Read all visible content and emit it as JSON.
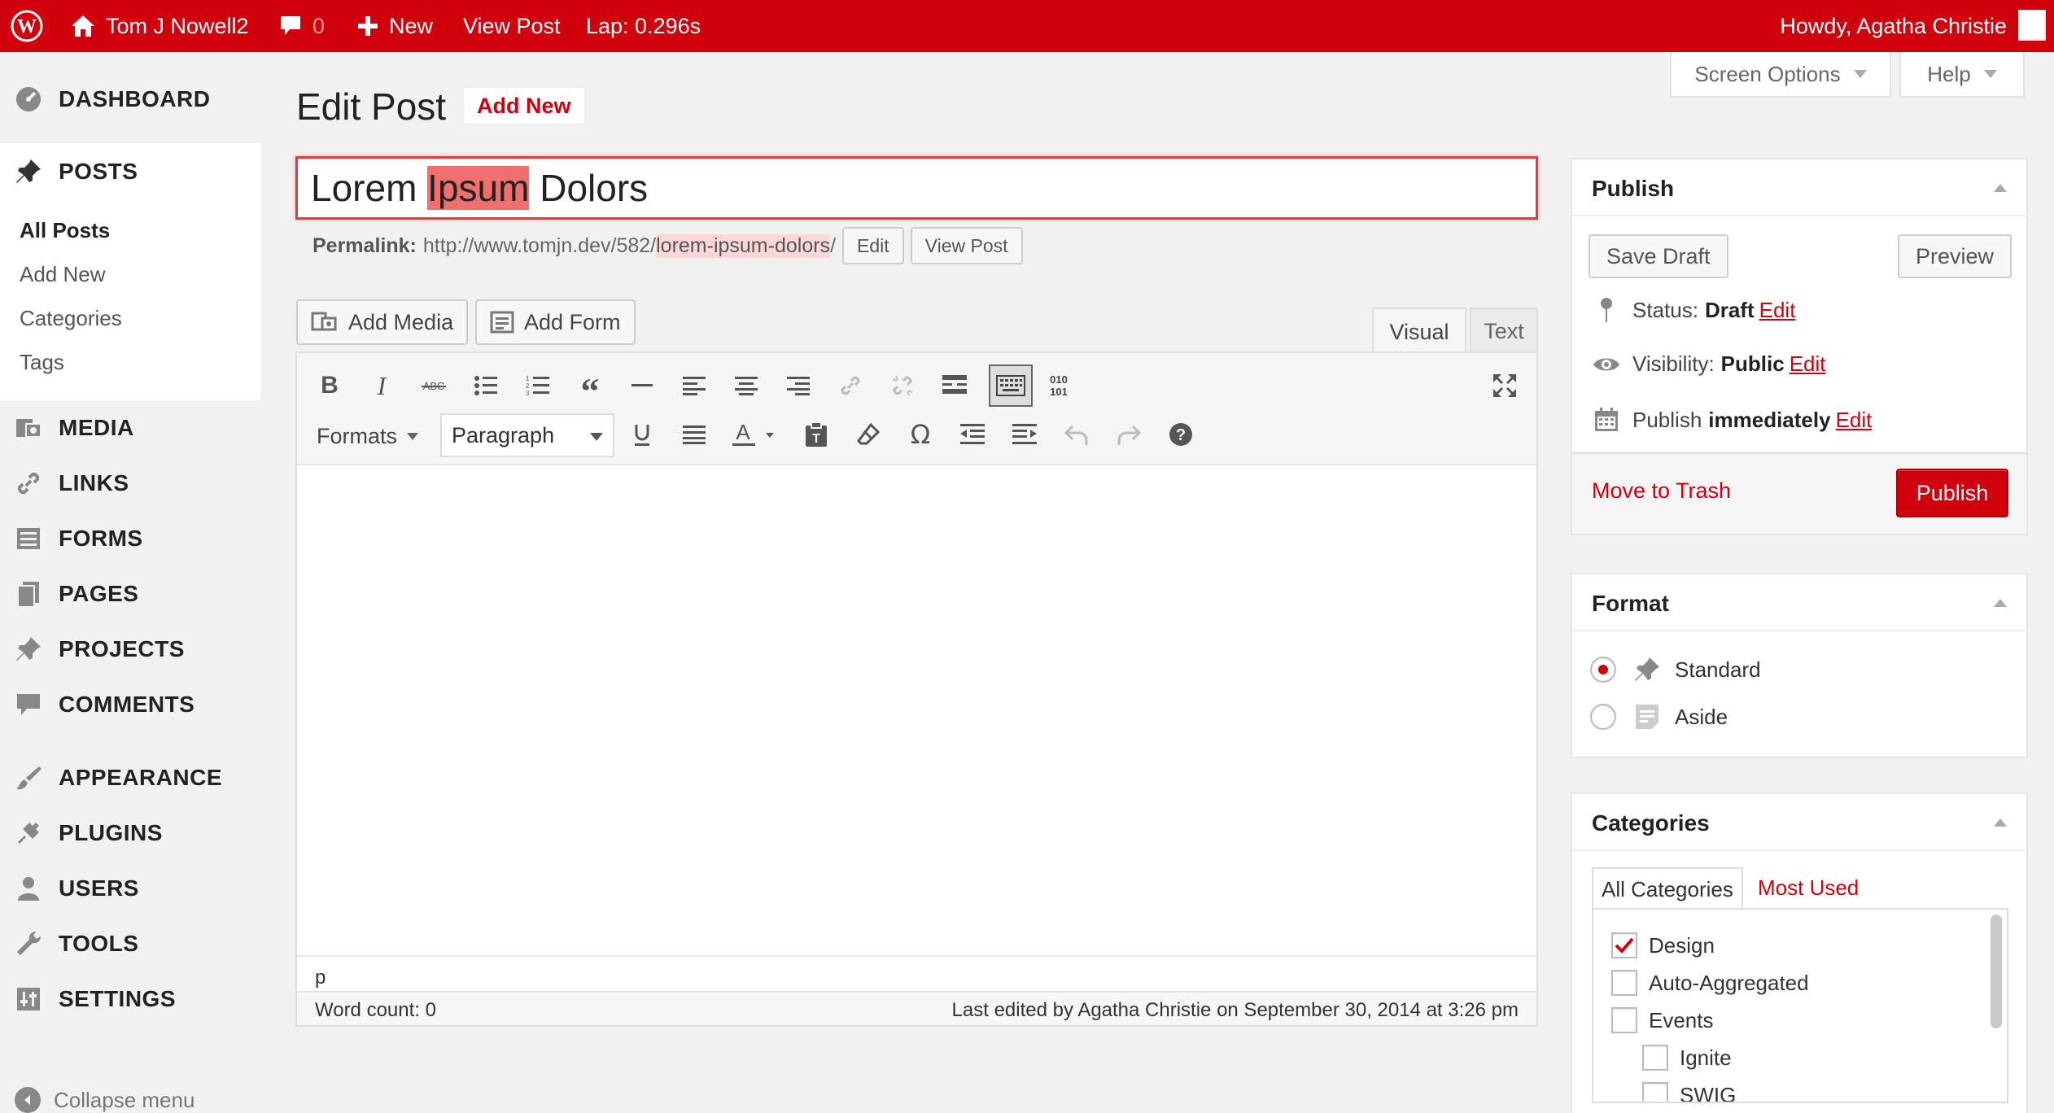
{
  "admin_bar": {
    "site_name": "Tom J Nowell2",
    "comments_count": "0",
    "new_label": "New",
    "view_post_label": "View Post",
    "lap": "Lap: 0.296s",
    "howdy": "Howdy, Agatha Christie"
  },
  "sidebar": {
    "dashboard": "Dashboard",
    "posts": "Posts",
    "submenu": {
      "all_posts": "All Posts",
      "add_new": "Add New",
      "categories": "Categories",
      "tags": "Tags"
    },
    "media": "Media",
    "links": "Links",
    "forms": "Forms",
    "pages": "Pages",
    "projects": "Projects",
    "comments": "Comments",
    "appearance": "Appearance",
    "plugins": "Plugins",
    "users": "Users",
    "tools": "Tools",
    "settings": "Settings",
    "collapse": "Collapse menu"
  },
  "screen_meta": {
    "screen_options": "Screen Options",
    "help": "Help"
  },
  "heading": {
    "title": "Edit Post",
    "add_new": "Add New"
  },
  "post": {
    "title_before": "Lorem ",
    "title_highlight": "Ipsum",
    "title_after": " Dolors",
    "permalink_label": "Permalink:",
    "permalink_base": "http://www.tomjn.dev/582/",
    "permalink_slug": "lorem-ipsum-dolors",
    "permalink_trail": "/",
    "permalink_edit": "Edit",
    "permalink_view": "View Post"
  },
  "media_buttons": {
    "add_media": "Add Media",
    "add_form": "Add Form"
  },
  "editor": {
    "tab_visual": "Visual",
    "tab_text": "Text",
    "formats": "Formats",
    "paragraph": "Paragraph",
    "path": "p",
    "word_count": "Word count: 0",
    "last_edited": "Last edited by Agatha Christie on September 30, 2014 at 3:26 pm",
    "code_top": "010",
    "code_bottom": "101"
  },
  "publish_box": {
    "title": "Publish",
    "save_draft": "Save Draft",
    "preview": "Preview",
    "status_label": "Status:",
    "status_value": "Draft",
    "visibility_label": "Visibility:",
    "visibility_value": "Public",
    "publish_label": "Publish",
    "publish_value": "immediately",
    "edit": "Edit",
    "move_to_trash": "Move to Trash",
    "publish_button": "Publish"
  },
  "format_box": {
    "title": "Format",
    "options": [
      "Standard",
      "Aside"
    ],
    "selected": "Standard"
  },
  "categories_box": {
    "title": "Categories",
    "tab_all": "All Categories",
    "tab_most_used": "Most Used",
    "items": [
      {
        "label": "Design",
        "checked": true,
        "level": 0
      },
      {
        "label": "Auto-Aggregated",
        "checked": false,
        "level": 0
      },
      {
        "label": "Events",
        "checked": false,
        "level": 0
      },
      {
        "label": "Ignite",
        "checked": false,
        "level": 1
      },
      {
        "label": "SWIG",
        "checked": false,
        "level": 1
      }
    ]
  },
  "colors": {
    "admin_bar": "#d1000d",
    "accent": "#d1000d",
    "background": "#f1f1f1"
  }
}
